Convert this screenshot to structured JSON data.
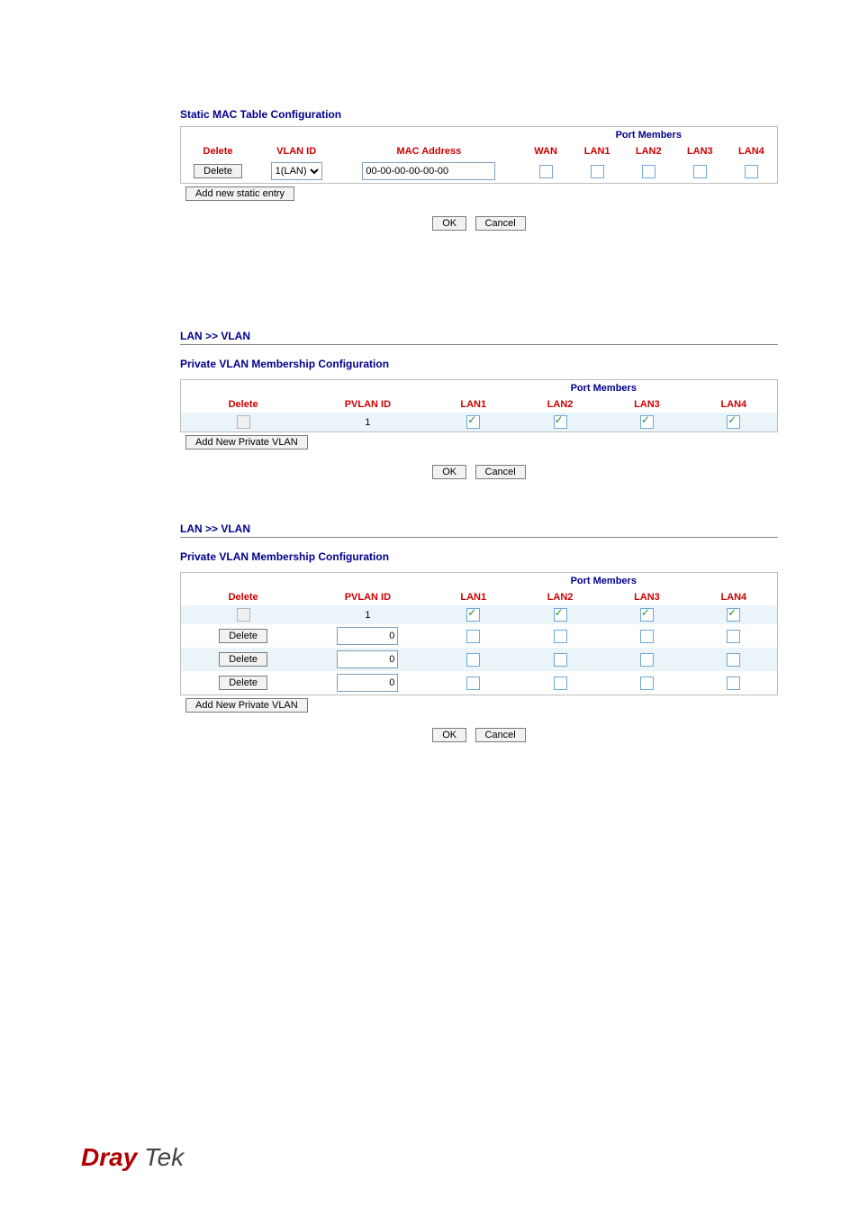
{
  "static_mac": {
    "title": "Static MAC Table Configuration",
    "headers": {
      "delete": "Delete",
      "vlan_id": "VLAN ID",
      "mac": "MAC Address",
      "port_members": "Port Members",
      "ports": [
        "WAN",
        "LAN1",
        "LAN2",
        "LAN3",
        "LAN4"
      ]
    },
    "row": {
      "delete_btn": "Delete",
      "vlan_option": "1(LAN)",
      "mac_value": "00-00-00-00-00-00",
      "ports_checked": [
        false,
        false,
        false,
        false,
        false
      ]
    },
    "add_btn": "Add new static entry",
    "ok": "OK",
    "cancel": "Cancel"
  },
  "pvlan1": {
    "breadcrumb": "LAN >> VLAN",
    "title": "Private VLAN Membership Configuration",
    "headers": {
      "delete": "Delete",
      "pvlan_id": "PVLAN ID",
      "port_members": "Port Members",
      "ports": [
        "LAN1",
        "LAN2",
        "LAN3",
        "LAN4"
      ]
    },
    "row": {
      "pvlan_id": "1",
      "delete_disabled": true,
      "ports_checked": [
        true,
        true,
        true,
        true
      ]
    },
    "add_btn": "Add New Private VLAN",
    "ok": "OK",
    "cancel": "Cancel"
  },
  "pvlan2": {
    "breadcrumb": "LAN >> VLAN",
    "title": "Private VLAN Membership Configuration",
    "headers": {
      "delete": "Delete",
      "pvlan_id": "PVLAN ID",
      "port_members": "Port Members",
      "ports": [
        "LAN1",
        "LAN2",
        "LAN3",
        "LAN4"
      ]
    },
    "rows": [
      {
        "delete_btn": null,
        "delete_disabled": true,
        "pvlan_id_display": "1",
        "pvlan_id_input": null,
        "ports_checked": [
          true,
          true,
          true,
          true
        ],
        "alt": true
      },
      {
        "delete_btn": "Delete",
        "delete_disabled": false,
        "pvlan_id_display": null,
        "pvlan_id_input": "0",
        "ports_checked": [
          false,
          false,
          false,
          false
        ],
        "alt": false
      },
      {
        "delete_btn": "Delete",
        "delete_disabled": false,
        "pvlan_id_display": null,
        "pvlan_id_input": "0",
        "ports_checked": [
          false,
          false,
          false,
          false
        ],
        "alt": true
      },
      {
        "delete_btn": "Delete",
        "delete_disabled": false,
        "pvlan_id_display": null,
        "pvlan_id_input": "0",
        "ports_checked": [
          false,
          false,
          false,
          false
        ],
        "alt": false
      }
    ],
    "add_btn": "Add New Private VLAN",
    "ok": "OK",
    "cancel": "Cancel"
  },
  "footer": {
    "brand_left": "Dray",
    "brand_right": " Tek"
  }
}
